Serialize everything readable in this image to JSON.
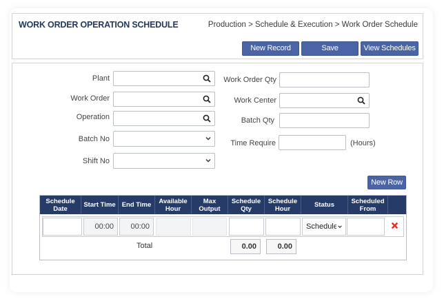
{
  "header": {
    "title": "WORK ORDER OPERATION SCHEDULE",
    "breadcrumb": "Production > Schedule & Execution > Work Order Schedule",
    "buttons": {
      "new_record": "New Record",
      "save": "Save",
      "view_schedules": "View Schedules"
    }
  },
  "form": {
    "plant": {
      "label": "Plant",
      "value": ""
    },
    "work_order": {
      "label": "Work Order",
      "value": ""
    },
    "operation": {
      "label": "Operation",
      "value": ""
    },
    "batch_no": {
      "label": "Batch No",
      "value": ""
    },
    "shift_no": {
      "label": "Shift No",
      "value": ""
    },
    "work_order_qty": {
      "label": "Work Order Qty",
      "value": ""
    },
    "work_center": {
      "label": "Work  Center",
      "value": ""
    },
    "batch_qty": {
      "label": "Batch Qty",
      "value": ""
    },
    "time_require": {
      "label": "Time Require",
      "value": "",
      "unit": "(Hours)"
    }
  },
  "table": {
    "new_row_label": "New Row",
    "columns": [
      {
        "label": "Schedule\nDate"
      },
      {
        "label": "Start Time"
      },
      {
        "label": "End Time"
      },
      {
        "label": "Available\nHour"
      },
      {
        "label": "Max\nOutput"
      },
      {
        "label": "Schedule\nQty"
      },
      {
        "label": "Schedule\nHour"
      },
      {
        "label": "Status"
      },
      {
        "label": "Scheduled\nFrom"
      },
      {
        "label": ""
      }
    ],
    "rows": [
      {
        "schedule_date": "",
        "start_time": "00:00",
        "end_time": "00:00",
        "available_hour": "",
        "max_output": "",
        "schedule_qty": "",
        "schedule_hour": "",
        "status": "Scheduled",
        "scheduled_from": ""
      }
    ],
    "total_label": "Total",
    "total_qty": "0.00",
    "total_hour": "0.00"
  },
  "colors": {
    "primary": "#4a64a6",
    "header_bg": "#273b69",
    "title": "#24385f",
    "delete": "#d9352b"
  },
  "icons": {
    "search": "search-icon",
    "dropdown": "chevron-down-icon",
    "delete": "close-icon"
  }
}
